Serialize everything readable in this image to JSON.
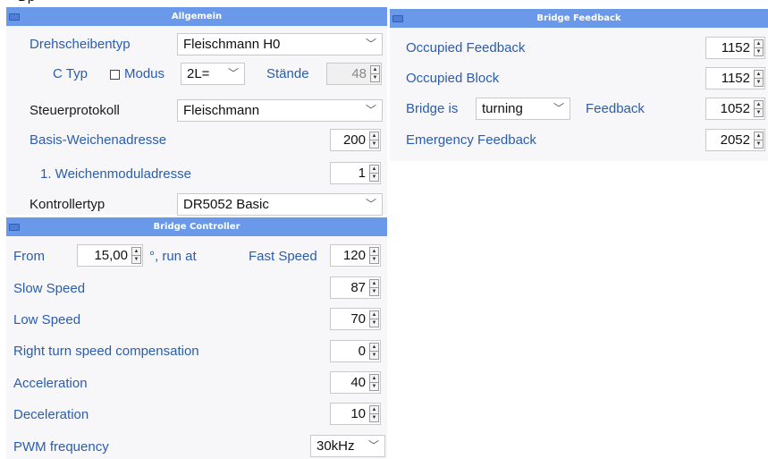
{
  "top_clip_text": "Dp",
  "allgemein": {
    "title": "Allgemein",
    "drehscheibentyp_label": "Drehscheibentyp",
    "drehscheibentyp_value": "Fleischmann H0",
    "ctyp_label": "C Typ",
    "modus_label": "Modus",
    "modus_checked": false,
    "ctyp_value": "2L=",
    "staende_label": "Stände",
    "staende_value": "48",
    "steuerprotokoll_label": "Steuerprotokoll",
    "steuerprotokoll_value": "Fleischmann",
    "basis_label": "Basis-Weichenadresse",
    "basis_value": "200",
    "weichenmodul_label": "1. Weichenmoduladresse",
    "weichenmodul_value": "1",
    "kontrollertyp_label": "Kontrollertyp",
    "kontrollertyp_value": "DR5052 Basic"
  },
  "feedback": {
    "title": "Bridge Feedback",
    "occupied_feedback_label": "Occupied Feedback",
    "occupied_feedback_value": "1152",
    "occupied_block_label": "Occupied Block",
    "occupied_block_value": "1152",
    "bridge_is_label": "Bridge is",
    "bridge_is_value": "turning",
    "feedback_label": "Feedback",
    "feedback_value": "1052",
    "emergency_label": "Emergency Feedback",
    "emergency_value": "2052"
  },
  "controller": {
    "title": "Bridge Controller",
    "from_label": "From",
    "from_value": "15,00",
    "run_at_label": "°, run at",
    "fast_speed_label": "Fast Speed",
    "fast_speed_value": "120",
    "slow_speed_label": "Slow Speed",
    "slow_speed_value": "87",
    "low_speed_label": "Low Speed",
    "low_speed_value": "70",
    "right_turn_label": "Right turn speed compensation",
    "right_turn_value": "0",
    "acceleration_label": "Acceleration",
    "acceleration_value": "40",
    "deceleration_label": "Deceleration",
    "deceleration_value": "10",
    "pwm_label": "PWM frequency",
    "pwm_value": "30kHz"
  },
  "icons": {
    "dropdown": "chevron-down-icon",
    "spin": "spin-arrows-icon"
  }
}
